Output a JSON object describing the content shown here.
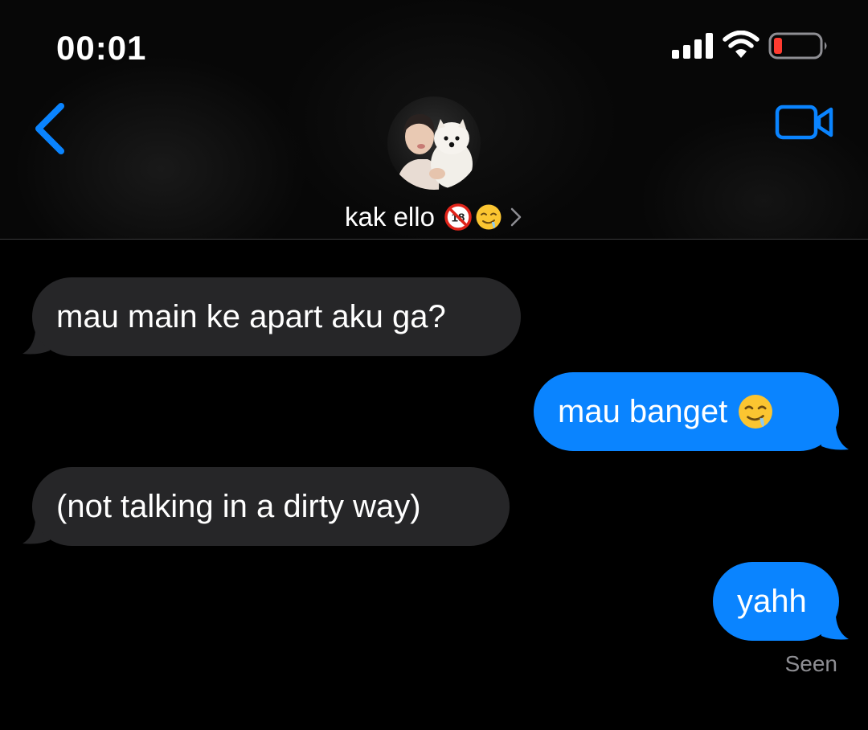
{
  "status_bar": {
    "time": "00:01",
    "icons": [
      "signal-icon",
      "wifi-icon",
      "battery-low-icon"
    ],
    "battery_color": "#ff3b30"
  },
  "nav": {
    "back_icon": "chevron-left-icon",
    "video_icon": "video-camera-icon",
    "accent": "#0a84ff"
  },
  "contact": {
    "name": "kak ello",
    "name_emojis": [
      "no-one-under-eighteen-emoji",
      "drooling-face-emoji"
    ],
    "badge_text": "18"
  },
  "messages": [
    {
      "direction": "received",
      "text": "mau main ke apart aku ga?"
    },
    {
      "direction": "sent",
      "text": "mau banget",
      "emoji": "drooling-face-emoji"
    },
    {
      "direction": "received",
      "text": "(not talking in a dirty way)"
    },
    {
      "direction": "sent",
      "text": "yahh"
    }
  ],
  "read_receipt": "Seen",
  "colors": {
    "sent_bubble": "#0a84ff",
    "received_bubble": "#262628",
    "background": "#000000"
  }
}
